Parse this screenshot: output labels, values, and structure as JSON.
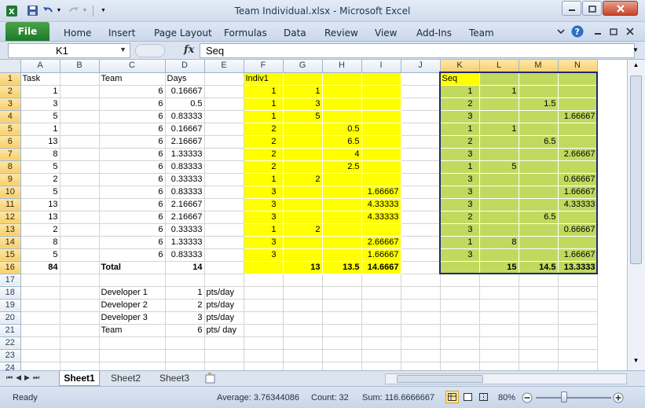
{
  "window": {
    "title": "Team Individual.xlsx  -  Microsoft Excel"
  },
  "icons": {
    "app": "excel-icon",
    "save": "save-icon",
    "undo": "undo-icon",
    "redo": "redo-icon"
  },
  "ribbon": {
    "tabs": [
      "File",
      "Home",
      "Insert",
      "Page Layout",
      "Formulas",
      "Data",
      "Review",
      "View",
      "Add-Ins",
      "Team"
    ]
  },
  "formula_bar": {
    "name_box": "K1",
    "fx_label": "fx",
    "content": "Seq"
  },
  "grid": {
    "columns": [
      "A",
      "B",
      "C",
      "D",
      "E",
      "F",
      "G",
      "H",
      "I",
      "J",
      "K",
      "L",
      "M",
      "N"
    ],
    "rows": [
      [
        "Task",
        "",
        "Team",
        "Days",
        "",
        "Indiv1",
        "",
        "",
        "",
        "",
        "Seq",
        "",
        "",
        ""
      ],
      [
        "1",
        "",
        "6",
        "0.16667",
        "",
        "1",
        "1",
        "",
        "",
        "",
        "1",
        "1",
        "",
        ""
      ],
      [
        "3",
        "",
        "6",
        "0.5",
        "",
        "1",
        "3",
        "",
        "",
        "",
        "2",
        "",
        "1.5",
        ""
      ],
      [
        "5",
        "",
        "6",
        "0.83333",
        "",
        "1",
        "5",
        "",
        "",
        "",
        "3",
        "",
        "",
        "1.66667"
      ],
      [
        "1",
        "",
        "6",
        "0.16667",
        "",
        "2",
        "",
        "0.5",
        "",
        "",
        "1",
        "1",
        "",
        ""
      ],
      [
        "13",
        "",
        "6",
        "2.16667",
        "",
        "2",
        "",
        "6.5",
        "",
        "",
        "2",
        "",
        "6.5",
        ""
      ],
      [
        "8",
        "",
        "6",
        "1.33333",
        "",
        "2",
        "",
        "4",
        "",
        "",
        "3",
        "",
        "",
        "2.66667"
      ],
      [
        "5",
        "",
        "6",
        "0.83333",
        "",
        "2",
        "",
        "2.5",
        "",
        "",
        "1",
        "5",
        "",
        ""
      ],
      [
        "2",
        "",
        "6",
        "0.33333",
        "",
        "1",
        "2",
        "",
        "",
        "",
        "3",
        "",
        "",
        "0.66667"
      ],
      [
        "5",
        "",
        "6",
        "0.83333",
        "",
        "3",
        "",
        "",
        "1.66667",
        "",
        "3",
        "",
        "",
        "1.66667"
      ],
      [
        "13",
        "",
        "6",
        "2.16667",
        "",
        "3",
        "",
        "",
        "4.33333",
        "",
        "3",
        "",
        "",
        "4.33333"
      ],
      [
        "13",
        "",
        "6",
        "2.16667",
        "",
        "3",
        "",
        "",
        "4.33333",
        "",
        "2",
        "",
        "6.5",
        ""
      ],
      [
        "2",
        "",
        "6",
        "0.33333",
        "",
        "1",
        "2",
        "",
        "",
        "",
        "3",
        "",
        "",
        "0.66667"
      ],
      [
        "8",
        "",
        "6",
        "1.33333",
        "",
        "3",
        "",
        "",
        "2.66667",
        "",
        "1",
        "8",
        "",
        ""
      ],
      [
        "5",
        "",
        "6",
        "0.83333",
        "",
        "3",
        "",
        "",
        "1.66667",
        "",
        "3",
        "",
        "",
        "1.66667"
      ],
      [
        "84",
        "",
        "Total",
        "14",
        "",
        "",
        "13",
        "13.5",
        "14.6667",
        "",
        "",
        "15",
        "14.5",
        "13.3333"
      ],
      [
        "",
        "",
        "",
        "",
        "",
        "",
        "",
        "",
        "",
        "",
        "",
        "",
        "",
        ""
      ],
      [
        "",
        "",
        "Developer 1",
        "1",
        "pts/day",
        "",
        "",
        "",
        "",
        "",
        "",
        "",
        "",
        ""
      ],
      [
        "",
        "",
        "Developer 2",
        "2",
        "pts/day",
        "",
        "",
        "",
        "",
        "",
        "",
        "",
        "",
        ""
      ],
      [
        "",
        "",
        "Developer 3",
        "3",
        "pts/day",
        "",
        "",
        "",
        "",
        "",
        "",
        "",
        "",
        ""
      ],
      [
        "",
        "",
        "Team",
        "6",
        "pts/ day",
        "",
        "",
        "",
        "",
        "",
        "",
        "",
        "",
        ""
      ],
      [
        "",
        "",
        "",
        "",
        "",
        "",
        "",
        "",
        "",
        "",
        "",
        "",
        "",
        ""
      ],
      [
        "",
        "",
        "",
        "",
        "",
        "",
        "",
        "",
        "",
        "",
        "",
        "",
        "",
        ""
      ],
      [
        "",
        "",
        "",
        "",
        "",
        "",
        "",
        "",
        "",
        "",
        "",
        "",
        "",
        ""
      ]
    ],
    "colors": {
      "yellow": "#ffff00",
      "green": "#c1d95f",
      "selection_border": "#1f2a6b"
    }
  },
  "sheets": [
    "Sheet1",
    "Sheet2",
    "Sheet3"
  ],
  "status": {
    "mode": "Ready",
    "average": "Average: 3.76344086",
    "count": "Count: 32",
    "sum": "Sum: 116.6666667",
    "zoom": "80%"
  }
}
